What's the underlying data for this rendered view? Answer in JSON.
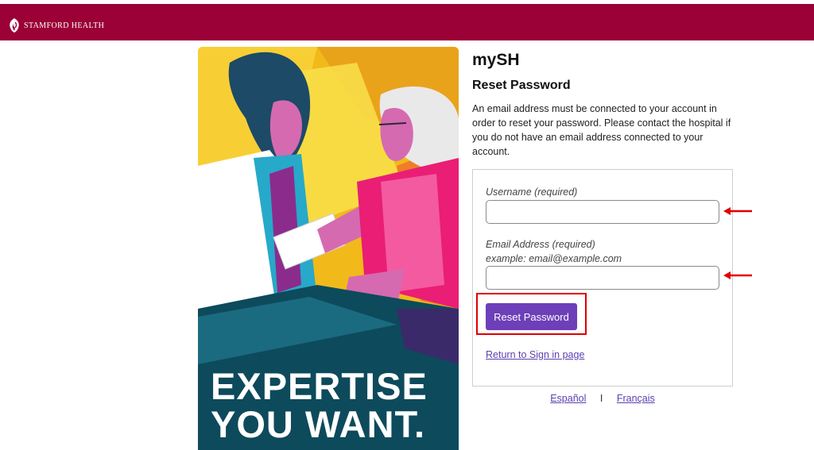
{
  "header": {
    "brand_name": "Stamford Health",
    "background_color": "#9b0036",
    "logo_icon": "stamford-health-logo-icon"
  },
  "hero": {
    "line1": "EXPERTISE",
    "line2": "YOU WANT."
  },
  "main": {
    "app_title": "mySH",
    "heading": "Reset Password",
    "info": "An email address must be connected to your account in order to reset your password. Please contact the hospital if you do not have an email address connected to your account."
  },
  "form": {
    "username_label": "Username (required)",
    "username_value": "",
    "email_label": "Email Address (required)",
    "email_example": "example: email@example.com",
    "email_value": "",
    "submit_label": "Reset Password",
    "return_link": "Return to Sign in page",
    "button_color": "#6d3fb8"
  },
  "annotations": {
    "arrow_color": "#e00000",
    "highlight_color": "#e00000"
  },
  "footer": {
    "languages": [
      "Español",
      "Français"
    ],
    "separator": "I"
  }
}
